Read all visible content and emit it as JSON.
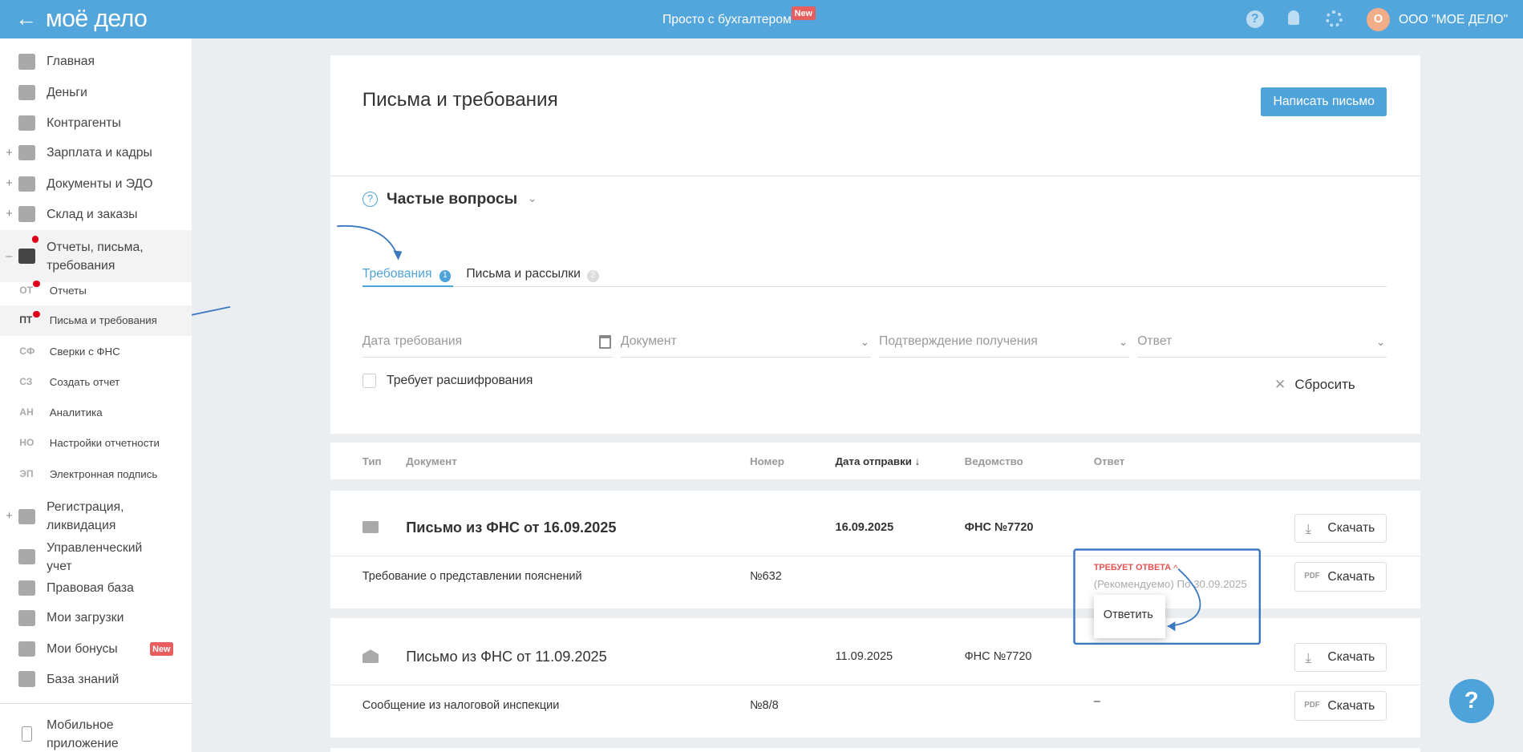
{
  "header": {
    "logo": "моё дело",
    "center": "Просто с бухгалтером",
    "center_badge": "New",
    "avatar_letter": "О",
    "org": "ООО \"МОЕ ДЕЛО\""
  },
  "sidebar": {
    "items": [
      {
        "label": "Главная",
        "icon": "home-icon"
      },
      {
        "label": "Деньги",
        "icon": "money-icon"
      },
      {
        "label": "Контрагенты",
        "icon": "contractors-icon"
      },
      {
        "label": "Зарплата и кадры",
        "icon": "wallet-icon",
        "expand": "+"
      },
      {
        "label": "Документы и ЭДО",
        "icon": "folder-icon",
        "expand": "+"
      },
      {
        "label": "Склад и заказы",
        "icon": "cart-icon",
        "expand": "+"
      },
      {
        "label": "Отчеты, письма, требования",
        "icon": "report-icon",
        "expand": "–"
      }
    ],
    "subitems": [
      {
        "abbr": "ОТ",
        "label": "Отчеты"
      },
      {
        "abbr": "ПТ",
        "label": "Письма и требования"
      },
      {
        "abbr": "СФ",
        "label": "Сверки с ФНС"
      },
      {
        "abbr": "СЗ",
        "label": "Создать отчет"
      },
      {
        "abbr": "АН",
        "label": "Аналитика"
      },
      {
        "abbr": "НО",
        "label": "Настройки отчетности"
      },
      {
        "abbr": "ЭП",
        "label": "Электронная подпись"
      }
    ],
    "items2": [
      {
        "label": "Регистрация, ликвидация",
        "expand": "+"
      },
      {
        "label": "Управленческий учет"
      },
      {
        "label": "Правовая база"
      },
      {
        "label": "Мои загрузки"
      },
      {
        "label": "Мои бонусы",
        "badge": "New"
      },
      {
        "label": "База знаний"
      },
      {
        "label": "Мобильное приложение"
      }
    ]
  },
  "main": {
    "title": "Письма и требования",
    "write_button": "Написать письмо",
    "faq": "Частые вопросы",
    "tabs": [
      {
        "label": "Требования",
        "count": "1"
      },
      {
        "label": "Письма и рассылки",
        "count": "2"
      }
    ],
    "filters": {
      "date": "Дата требования",
      "document": "Документ",
      "confirmation": "Подтверждение получения",
      "answer": "Ответ",
      "decrypt": "Требует расшифрования",
      "reset": "Сбросить"
    },
    "columns": [
      "Тип",
      "Документ",
      "Номер",
      "Дата отправки ↓",
      "Ведомство",
      "Ответ"
    ],
    "rows": [
      {
        "title": "Письмо из ФНС от 16.09.2025",
        "date": "16.09.2025",
        "agency": "ФНС №7720",
        "download": "Скачать",
        "sub": {
          "doc": "Требование о представлении пояснений",
          "number": "№632",
          "status": "ТРЕБУЕТ ОТВЕТА",
          "deadline": "(Рекомендуемо) По 30.09.2025",
          "download": "Скачать",
          "pdf": "PDF"
        }
      },
      {
        "title": "Письмо из ФНС от 11.09.2025",
        "date": "11.09.2025",
        "agency": "ФНС №7720",
        "download": "Скачать",
        "sub": {
          "doc": "Сообщение из налоговой инспекции",
          "number": "№8/8",
          "answer": "–",
          "download": "Скачать",
          "pdf": "PDF"
        }
      }
    ],
    "popup": {
      "reply": "Ответить"
    }
  },
  "help": "?"
}
